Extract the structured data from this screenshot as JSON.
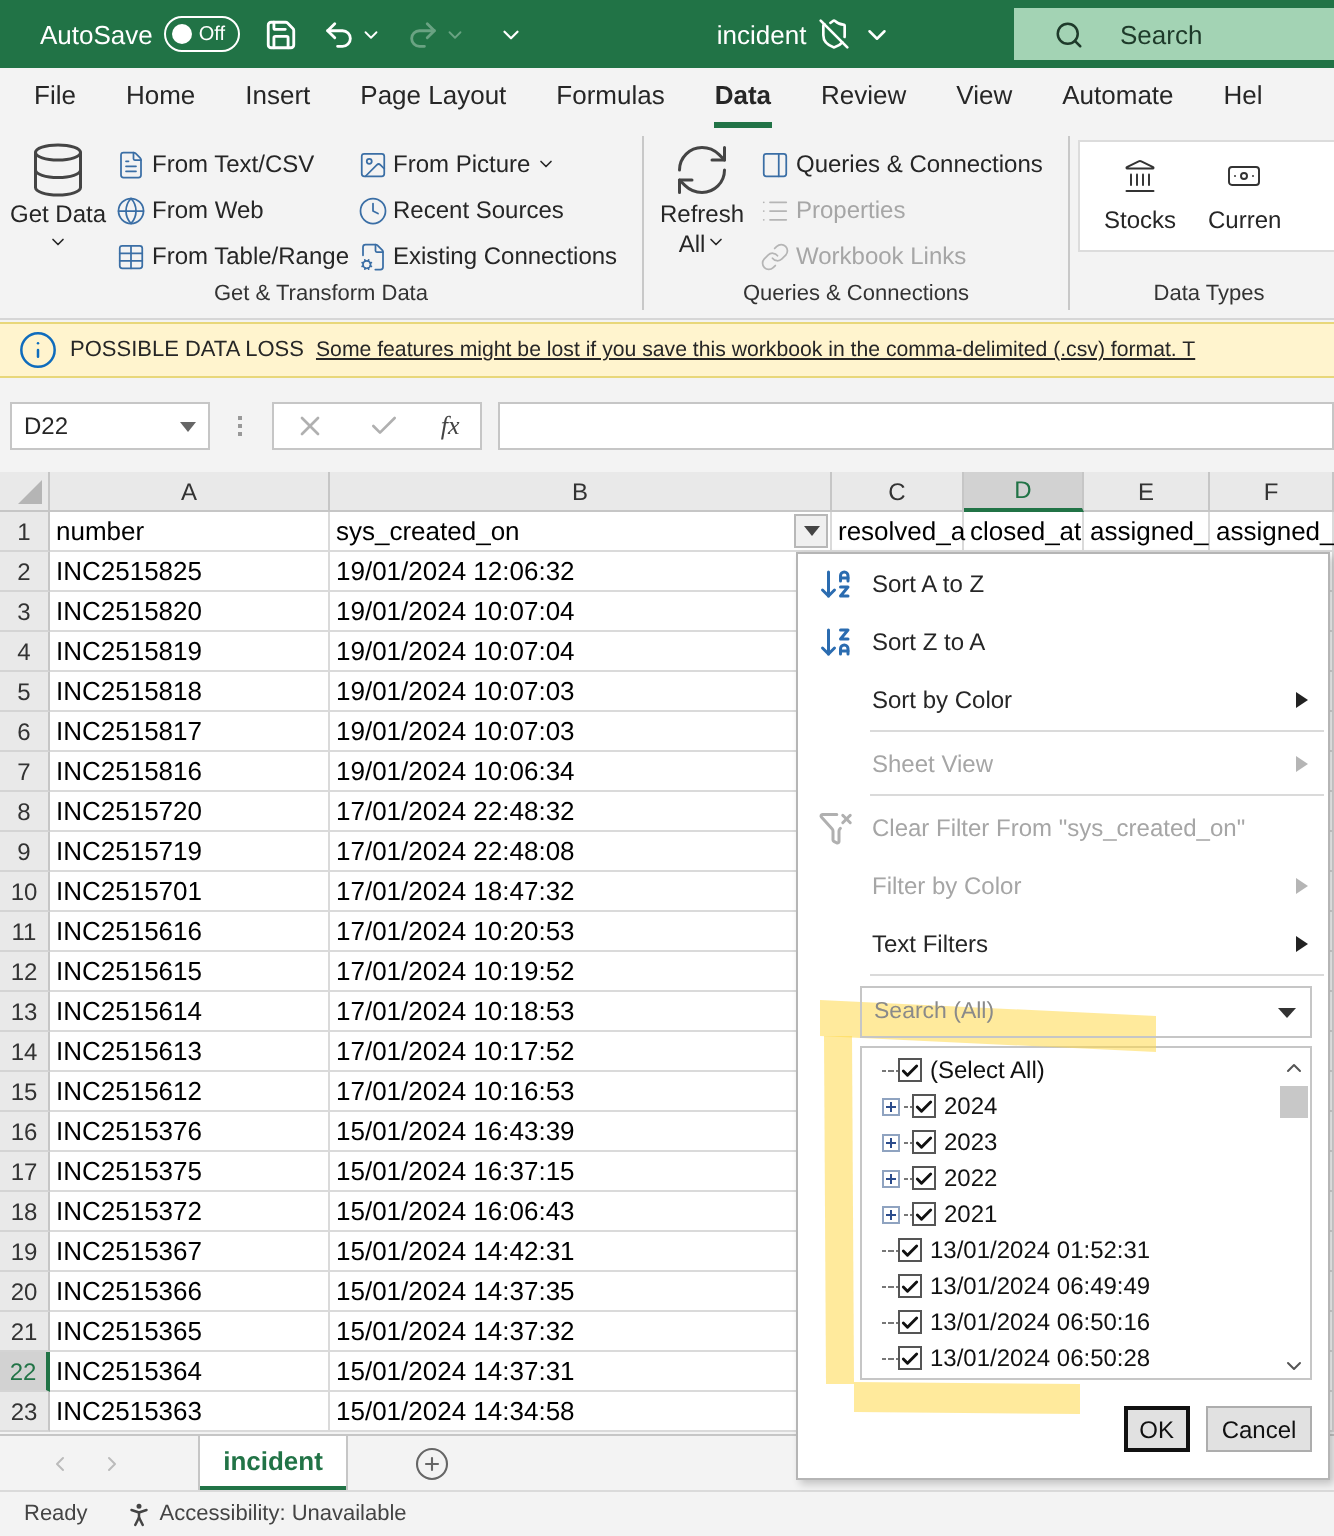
{
  "title_bar": {
    "autosave": {
      "label": "AutoSave",
      "toggle_label": "Off",
      "on": false
    },
    "title": "incident",
    "search": {
      "placeholder": "Search"
    }
  },
  "ribbon_tabs": [
    {
      "label": "File",
      "selected": false
    },
    {
      "label": "Home",
      "selected": false
    },
    {
      "label": "Insert",
      "selected": false
    },
    {
      "label": "Page Layout",
      "selected": false
    },
    {
      "label": "Formulas",
      "selected": false
    },
    {
      "label": "Data",
      "selected": true
    },
    {
      "label": "Review",
      "selected": false
    },
    {
      "label": "View",
      "selected": false
    },
    {
      "label": "Automate",
      "selected": false
    },
    {
      "label": "Hel",
      "selected": false
    }
  ],
  "ribbon_groups": [
    {
      "label": "Get & Transform Data",
      "large": [
        {
          "label": "Get Data",
          "dropdown": true
        }
      ],
      "small": [
        {
          "label": "From Text/CSV",
          "disabled": false,
          "dropdown": false
        },
        {
          "label": "From Web",
          "disabled": false,
          "dropdown": false
        },
        {
          "label": "From Table/Range",
          "disabled": false,
          "dropdown": false
        },
        {
          "label": "From Picture",
          "disabled": false,
          "dropdown": true
        },
        {
          "label": "Recent Sources",
          "disabled": false,
          "dropdown": false
        },
        {
          "label": "Existing Connections",
          "disabled": false,
          "dropdown": false
        }
      ]
    },
    {
      "label": "Queries & Connections",
      "large": [
        {
          "label": "Refresh All",
          "dropdown": true
        }
      ],
      "small": [
        {
          "label": "Queries & Connections",
          "disabled": false,
          "dropdown": false
        },
        {
          "label": "Properties",
          "disabled": true,
          "dropdown": false
        },
        {
          "label": "Workbook Links",
          "disabled": true,
          "dropdown": false
        }
      ]
    },
    {
      "label": "Data Types",
      "gallery": [
        {
          "label": "Stocks"
        },
        {
          "label": "Curren"
        }
      ]
    }
  ],
  "info_bar": {
    "title": "POSSIBLE DATA LOSS",
    "message": "Some features might be lost if you save this workbook in the comma-delimited (.csv) format. T"
  },
  "formula_bar": {
    "name_box": "D22",
    "function_label": "fx"
  },
  "sheet": {
    "columns": [
      {
        "label": "A",
        "selected": false
      },
      {
        "label": "B",
        "selected": false
      },
      {
        "label": "C",
        "selected": false
      },
      {
        "label": "D",
        "selected": true
      },
      {
        "label": "E",
        "selected": false
      },
      {
        "label": "F",
        "selected": false
      }
    ],
    "rows": [
      {
        "number": "1",
        "selected": false,
        "cells": [
          "number",
          "sys_created_on",
          "resolved_a",
          "closed_at",
          "assigned_",
          "assigned_"
        ]
      },
      {
        "number": "2",
        "selected": false,
        "cells": [
          "INC2515825",
          "19/01/2024 12:06:32"
        ]
      },
      {
        "number": "3",
        "selected": false,
        "cells": [
          "INC2515820",
          "19/01/2024 10:07:04"
        ]
      },
      {
        "number": "4",
        "selected": false,
        "cells": [
          "INC2515819",
          "19/01/2024 10:07:04"
        ]
      },
      {
        "number": "5",
        "selected": false,
        "cells": [
          "INC2515818",
          "19/01/2024 10:07:03"
        ]
      },
      {
        "number": "6",
        "selected": false,
        "cells": [
          "INC2515817",
          "19/01/2024 10:07:03"
        ]
      },
      {
        "number": "7",
        "selected": false,
        "cells": [
          "INC2515816",
          "19/01/2024 10:06:34"
        ]
      },
      {
        "number": "8",
        "selected": false,
        "cells": [
          "INC2515720",
          "17/01/2024 22:48:32"
        ]
      },
      {
        "number": "9",
        "selected": false,
        "cells": [
          "INC2515719",
          "17/01/2024 22:48:08"
        ]
      },
      {
        "number": "10",
        "selected": false,
        "cells": [
          "INC2515701",
          "17/01/2024 18:47:32"
        ]
      },
      {
        "number": "11",
        "selected": false,
        "cells": [
          "INC2515616",
          "17/01/2024 10:20:53"
        ]
      },
      {
        "number": "12",
        "selected": false,
        "cells": [
          "INC2515615",
          "17/01/2024 10:19:52"
        ]
      },
      {
        "number": "13",
        "selected": false,
        "cells": [
          "INC2515614",
          "17/01/2024 10:18:53"
        ]
      },
      {
        "number": "14",
        "selected": false,
        "cells": [
          "INC2515613",
          "17/01/2024 10:17:52"
        ]
      },
      {
        "number": "15",
        "selected": false,
        "cells": [
          "INC2515612",
          "17/01/2024 10:16:53"
        ]
      },
      {
        "number": "16",
        "selected": false,
        "cells": [
          "INC2515376",
          "15/01/2024 16:43:39"
        ]
      },
      {
        "number": "17",
        "selected": false,
        "cells": [
          "INC2515375",
          "15/01/2024 16:37:15"
        ]
      },
      {
        "number": "18",
        "selected": false,
        "cells": [
          "INC2515372",
          "15/01/2024 16:06:43"
        ]
      },
      {
        "number": "19",
        "selected": false,
        "cells": [
          "INC2515367",
          "15/01/2024 14:42:31"
        ]
      },
      {
        "number": "20",
        "selected": false,
        "cells": [
          "INC2515366",
          "15/01/2024 14:37:35"
        ]
      },
      {
        "number": "21",
        "selected": false,
        "cells": [
          "INC2515365",
          "15/01/2024 14:37:32"
        ]
      },
      {
        "number": "22",
        "selected": true,
        "cells": [
          "INC2515364",
          "15/01/2024 14:37:31"
        ]
      },
      {
        "number": "23",
        "selected": false,
        "cells": [
          "INC2515363",
          "15/01/2024 14:34:58"
        ]
      }
    ]
  },
  "filter_menu": {
    "items": [
      {
        "kind": "sort_ascending",
        "label": "Sort A to Z",
        "disabled": false,
        "submenu": false
      },
      {
        "kind": "sort_descending",
        "label": "Sort Z to A",
        "disabled": false,
        "submenu": false
      },
      {
        "kind": "command",
        "label": "Sort by Color",
        "disabled": false,
        "submenu": true
      },
      {
        "kind": "separator"
      },
      {
        "kind": "command",
        "label": "Sheet View",
        "disabled": true,
        "submenu": true
      },
      {
        "kind": "separator"
      },
      {
        "kind": "clear_filter",
        "label": "Clear Filter From \"sys_created_on\"",
        "disabled": true,
        "submenu": false
      },
      {
        "kind": "command",
        "label": "Filter by Color",
        "disabled": true,
        "submenu": true
      },
      {
        "kind": "command",
        "label": "Text Filters",
        "disabled": false,
        "submenu": true
      },
      {
        "kind": "separator"
      }
    ],
    "search": {
      "placeholder": "Search (All)"
    },
    "values": [
      {
        "kind": "all",
        "label": "(Select All)",
        "checked": true
      },
      {
        "kind": "group",
        "label": "2024",
        "checked": true,
        "expanded": false
      },
      {
        "kind": "group",
        "label": "2023",
        "checked": true,
        "expanded": false
      },
      {
        "kind": "group",
        "label": "2022",
        "checked": true,
        "expanded": false
      },
      {
        "kind": "group",
        "label": "2021",
        "checked": true,
        "expanded": false
      },
      {
        "kind": "item",
        "label": "13/01/2024 01:52:31",
        "checked": true
      },
      {
        "kind": "item",
        "label": "13/01/2024 06:49:49",
        "checked": true
      },
      {
        "kind": "item",
        "label": "13/01/2024 06:50:16",
        "checked": true
      },
      {
        "kind": "item",
        "label": "13/01/2024 06:50:28",
        "checked": true
      }
    ],
    "buttons": [
      {
        "label": "OK",
        "default": true
      },
      {
        "label": "Cancel",
        "default": false
      }
    ]
  },
  "sheet_tabs": [
    {
      "label": "incident",
      "selected": true
    }
  ],
  "status_bar": {
    "mode": "Ready",
    "accessibility": "Accessibility: Unavailable"
  }
}
